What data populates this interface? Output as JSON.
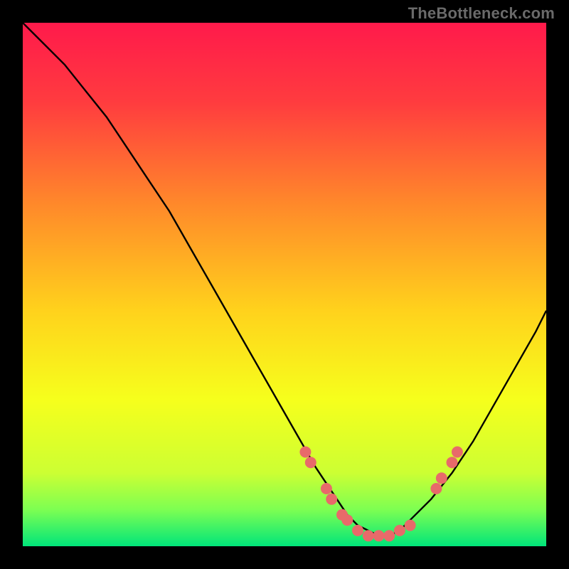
{
  "watermark": "TheBottleneck.com",
  "chart_data": {
    "type": "line",
    "title": "",
    "xlabel": "",
    "ylabel": "",
    "xlim": [
      0,
      100
    ],
    "ylim": [
      0,
      100
    ],
    "background_gradient": {
      "stops": [
        {
          "offset": 0.0,
          "color": "#ff1a4b"
        },
        {
          "offset": 0.15,
          "color": "#ff3b3f"
        },
        {
          "offset": 0.35,
          "color": "#ff8a2a"
        },
        {
          "offset": 0.55,
          "color": "#ffd21c"
        },
        {
          "offset": 0.72,
          "color": "#f6ff1c"
        },
        {
          "offset": 0.86,
          "color": "#ccff33"
        },
        {
          "offset": 0.93,
          "color": "#7dff52"
        },
        {
          "offset": 1.0,
          "color": "#00e57a"
        }
      ]
    },
    "series": [
      {
        "name": "bottleneck-curve",
        "x": [
          0,
          4,
          8,
          12,
          16,
          20,
          24,
          28,
          32,
          36,
          40,
          44,
          48,
          52,
          56,
          58,
          60,
          62,
          64,
          66,
          68,
          70,
          72,
          74,
          78,
          82,
          86,
          90,
          94,
          98,
          100
        ],
        "y": [
          100,
          96,
          92,
          87,
          82,
          76,
          70,
          64,
          57,
          50,
          43,
          36,
          29,
          22,
          15,
          12,
          9,
          6,
          4,
          3,
          2,
          2,
          3,
          5,
          9,
          14,
          20,
          27,
          34,
          41,
          45
        ]
      }
    ],
    "markers": {
      "name": "highlight-points",
      "color": "#e86a6a",
      "radius": 8,
      "points": [
        {
          "x": 54,
          "y": 18
        },
        {
          "x": 55,
          "y": 16
        },
        {
          "x": 58,
          "y": 11
        },
        {
          "x": 59,
          "y": 9
        },
        {
          "x": 61,
          "y": 6
        },
        {
          "x": 62,
          "y": 5
        },
        {
          "x": 64,
          "y": 3
        },
        {
          "x": 66,
          "y": 2
        },
        {
          "x": 68,
          "y": 2
        },
        {
          "x": 70,
          "y": 2
        },
        {
          "x": 72,
          "y": 3
        },
        {
          "x": 74,
          "y": 4
        },
        {
          "x": 79,
          "y": 11
        },
        {
          "x": 80,
          "y": 13
        },
        {
          "x": 82,
          "y": 16
        },
        {
          "x": 83,
          "y": 18
        }
      ]
    }
  }
}
